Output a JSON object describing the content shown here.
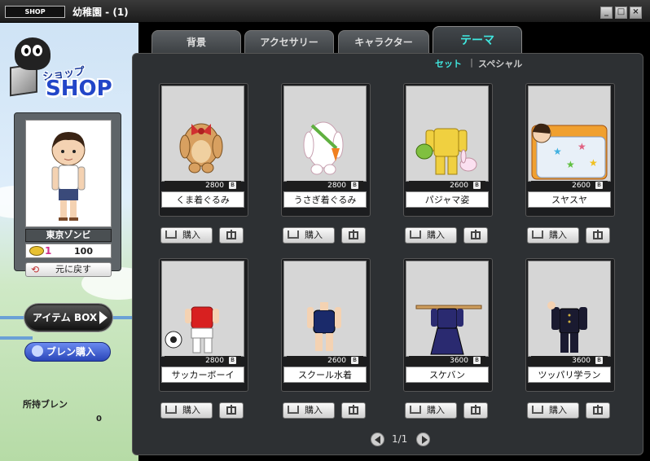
{
  "window": {
    "chip": "SHOP",
    "title": "幼稚園 - (1)"
  },
  "logo": {
    "small": "ショップ",
    "big": "SHOP"
  },
  "avatar": {
    "name": "東京ゾンビ",
    "coin_level": "1",
    "coins": "100",
    "reset_label": "元に戻す"
  },
  "side_buttons": {
    "item_box": "アイテム BOX",
    "bren_buy": "ブレン購入"
  },
  "bren": {
    "label": "所持ブレン",
    "value": "0"
  },
  "tabs": [
    {
      "label": "背景",
      "active": false
    },
    {
      "label": "アクセサリー",
      "active": false
    },
    {
      "label": "キャラクター",
      "active": false
    },
    {
      "label": "テーマ",
      "active": true
    }
  ],
  "subtabs": [
    {
      "label": "セット",
      "active": true
    },
    {
      "label": "スペシャル",
      "active": false
    }
  ],
  "items": [
    {
      "name": "くま着ぐるみ",
      "price": "2800",
      "icon": "bear-costume"
    },
    {
      "name": "うさぎ着ぐるみ",
      "price": "2800",
      "icon": "rabbit-costume"
    },
    {
      "name": "パジャマ姿",
      "price": "2600",
      "icon": "pajamas"
    },
    {
      "name": "スヤスヤ",
      "price": "2600",
      "icon": "sleeping-futon"
    },
    {
      "name": "サッカーボーイ",
      "price": "2800",
      "icon": "soccer-uniform"
    },
    {
      "name": "スクール水着",
      "price": "2600",
      "icon": "school-swimsuit"
    },
    {
      "name": "スケバン",
      "price": "3600",
      "icon": "sukeban-uniform"
    },
    {
      "name": "ツッパリ学ラン",
      "price": "3600",
      "icon": "gakuran-uniform"
    }
  ],
  "buttons": {
    "buy": "購入",
    "currency_badge": "B"
  },
  "pager": {
    "text": "1/1"
  }
}
